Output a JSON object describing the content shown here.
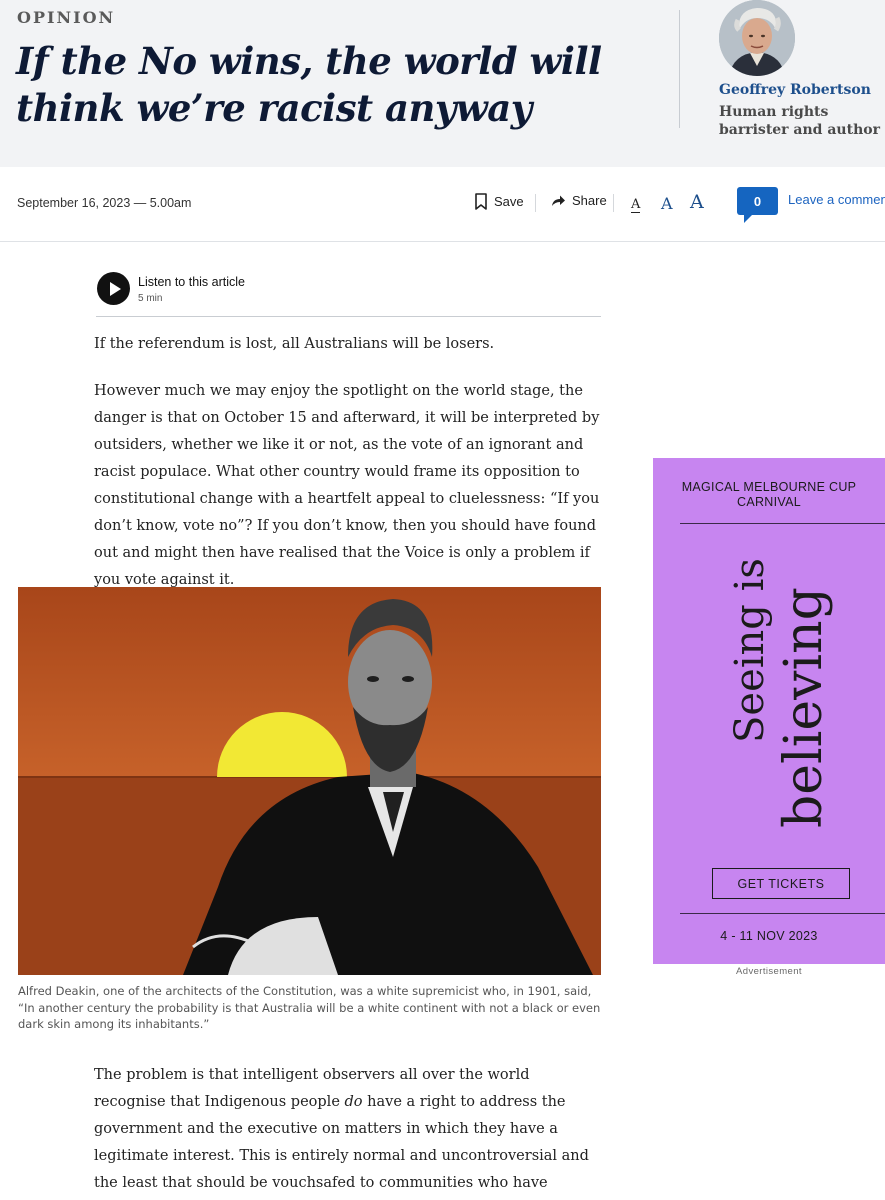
{
  "header": {
    "kicker": "OPINION",
    "headline": "If the No wins, the world will think we’re racist anyway",
    "author_name": "Geoffrey Robertson",
    "author_bio": "Human rights barrister and author"
  },
  "toolbar": {
    "date": "September 16, 2023 — 5.00am",
    "save_label": "Save",
    "share_label": "Share",
    "font_small": "A",
    "font_medium": "A",
    "font_large": "A",
    "comment_count": "0",
    "comment_label": "Leave a comment"
  },
  "audio": {
    "title": "Listen to this article",
    "duration": "5 min"
  },
  "article": {
    "p1": "If the referendum is lost, all Australians will be losers.",
    "p2": "However much we may enjoy the spotlight on the world stage, the danger is that on October 15 and afterward, it will be interpreted by outsiders, whether we like it or not, as the vote of an ignorant and racist populace. What other country would frame its opposition to constitutional change with a heartfelt appeal to cluelessness: “If you don’t know, vote no”? If you don’t know, then you should have found out and might then have realised that the Voice is only a problem if you vote against it.",
    "caption": "Alfred Deakin, one of the architects of the Constitution, was a white supremicist who, in 1901, said, “In another century the probability is that Australia will be a white continent with not a black or even dark skin among its inhabitants.”",
    "p3_before": "The problem is that intelligent observers all over the world recognise that Indigenous people ",
    "p3_em": "do",
    "p3_after": " have a right to address the government and the executive on matters in which they have a legitimate interest. This is entirely normal and uncontroversial and the least that should be vouchsafed to communities who have suffered genocide and displacement."
  },
  "ad": {
    "headline": "MAGICAL MELBOURNE CUP CARNIVAL",
    "tagline_1": "Seeing is",
    "tagline_2": "believing",
    "cta": "GET TICKETS",
    "dates": "4 - 11 NOV 2023",
    "label": "Advertisement"
  },
  "colors": {
    "header_bg": "#f2f3f5",
    "headline": "#0e1a35",
    "author_link": "#1d4f8c",
    "comment_badge": "#1565c0",
    "ad_bg": "#c785f0",
    "sunset": "#b5531f",
    "sun": "#f2e834"
  },
  "icons": [
    "bookmark-icon",
    "share-arrow-icon",
    "play-icon",
    "comment-bubble-icon"
  ]
}
